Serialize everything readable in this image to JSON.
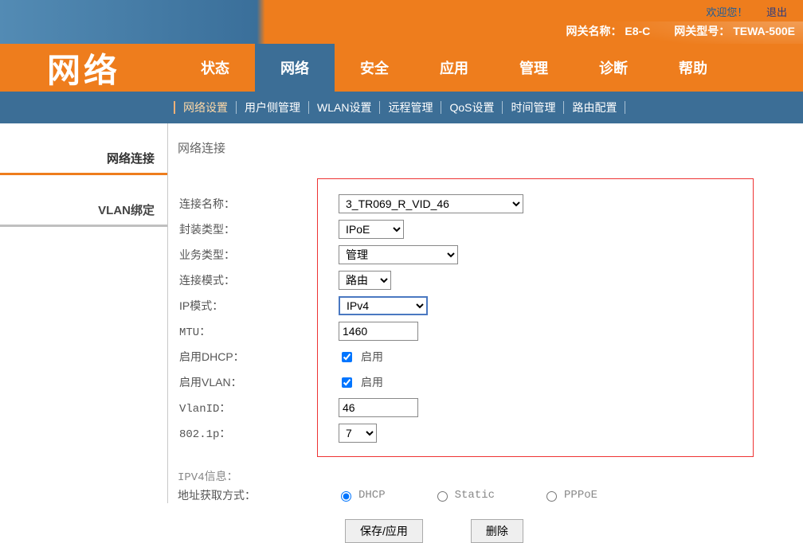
{
  "top": {
    "welcome": "欢迎您！",
    "logout": "退出",
    "gw_name_label": "网关名称：",
    "gw_name": "E8-C",
    "gw_model_label": "网关型号：",
    "gw_model": "TEWA-500E"
  },
  "title": "网络",
  "tabs": [
    "状态",
    "网络",
    "安全",
    "应用",
    "管理",
    "诊断",
    "帮助"
  ],
  "active_tab_index": 1,
  "subnav": [
    "网络设置",
    "用户侧管理",
    "WLAN设置",
    "远程管理",
    "QoS设置",
    "时间管理",
    "路由配置"
  ],
  "sidebar": [
    {
      "label": "网络连接",
      "active": true
    },
    {
      "label": "VLAN绑定",
      "active": false
    }
  ],
  "section_title": "网络连接",
  "form": {
    "conn_name": {
      "label": "连接名称：",
      "value": "3_TR069_R_VID_46"
    },
    "encap": {
      "label": "封装类型：",
      "value": "IPoE"
    },
    "service": {
      "label": "业务类型：",
      "value": "管理"
    },
    "conn_mode": {
      "label": "连接模式：",
      "value": "路由"
    },
    "ip_mode": {
      "label": "IP模式：",
      "value": "IPv4"
    },
    "mtu": {
      "label": "MTU：",
      "value": "1460"
    },
    "dhcp": {
      "label": "启用DHCP：",
      "text": "启用",
      "checked": true
    },
    "vlan_en": {
      "label": "启用VLAN：",
      "text": "启用",
      "checked": true
    },
    "vlan_id": {
      "label": "VlanID：",
      "value": "46"
    },
    "dot1p": {
      "label": "802.1p：",
      "value": "7"
    }
  },
  "ipv4": {
    "heading": "IPV4信息：",
    "addr_mode_label": "地址获取方式：",
    "options": [
      "DHCP",
      "Static",
      "PPPoE"
    ],
    "selected": "DHCP"
  },
  "buttons": {
    "save": "保存/应用",
    "delete": "删除"
  }
}
